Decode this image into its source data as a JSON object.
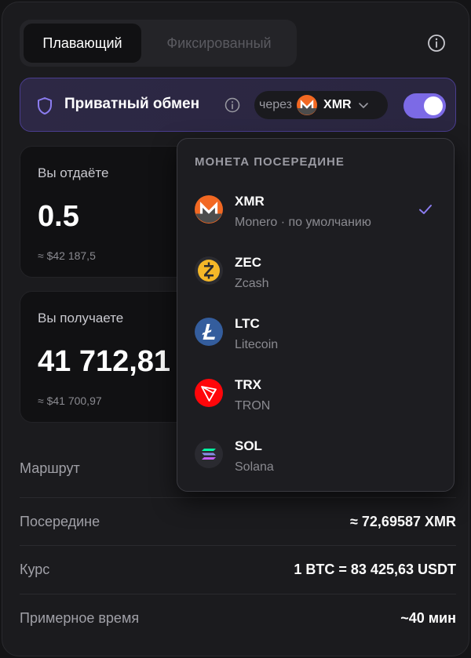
{
  "tabs": {
    "floating": "Плавающий",
    "fixed": "Фиксированный"
  },
  "private": {
    "label": "Приватный обмен",
    "via_text": "через",
    "via_ticker": "XMR",
    "toggle_on": true
  },
  "give": {
    "label": "Вы отдаёте",
    "value": "0.5",
    "usd": "≈ $42 187,5"
  },
  "get": {
    "label": "Вы получаете",
    "value": "41 712,81",
    "usd": "≈ $41 700,97"
  },
  "rows": {
    "route_label": "Маршрут",
    "mid_label": "Посередине",
    "mid_value": "≈ 72,69587 XMR",
    "rate_label": "Курс",
    "rate_value": "1 BTC = 83 425,63 USDT",
    "time_label": "Примерное время",
    "time_value": "~40 мин"
  },
  "dropdown": {
    "header": "МОНЕТА ПОСЕРЕДИНЕ",
    "items": [
      {
        "ticker": "XMR",
        "name": "Monero · по умолчанию",
        "icon": "monero-icon",
        "color": "#f26822",
        "selected": true
      },
      {
        "ticker": "ZEC",
        "name": "Zcash",
        "icon": "zcash-icon",
        "color": "#f4b728",
        "selected": false
      },
      {
        "ticker": "LTC",
        "name": "Litecoin",
        "icon": "litecoin-icon",
        "color": "#345d9d",
        "selected": false
      },
      {
        "ticker": "TRX",
        "name": "TRON",
        "icon": "tron-icon",
        "color": "#ff060a",
        "selected": false
      },
      {
        "ticker": "SOL",
        "name": "Solana",
        "icon": "solana-icon",
        "color": "#2a2a30",
        "selected": false
      }
    ]
  },
  "colors": {
    "accent": "#7c6ae6",
    "check": "#8b7cf0"
  }
}
